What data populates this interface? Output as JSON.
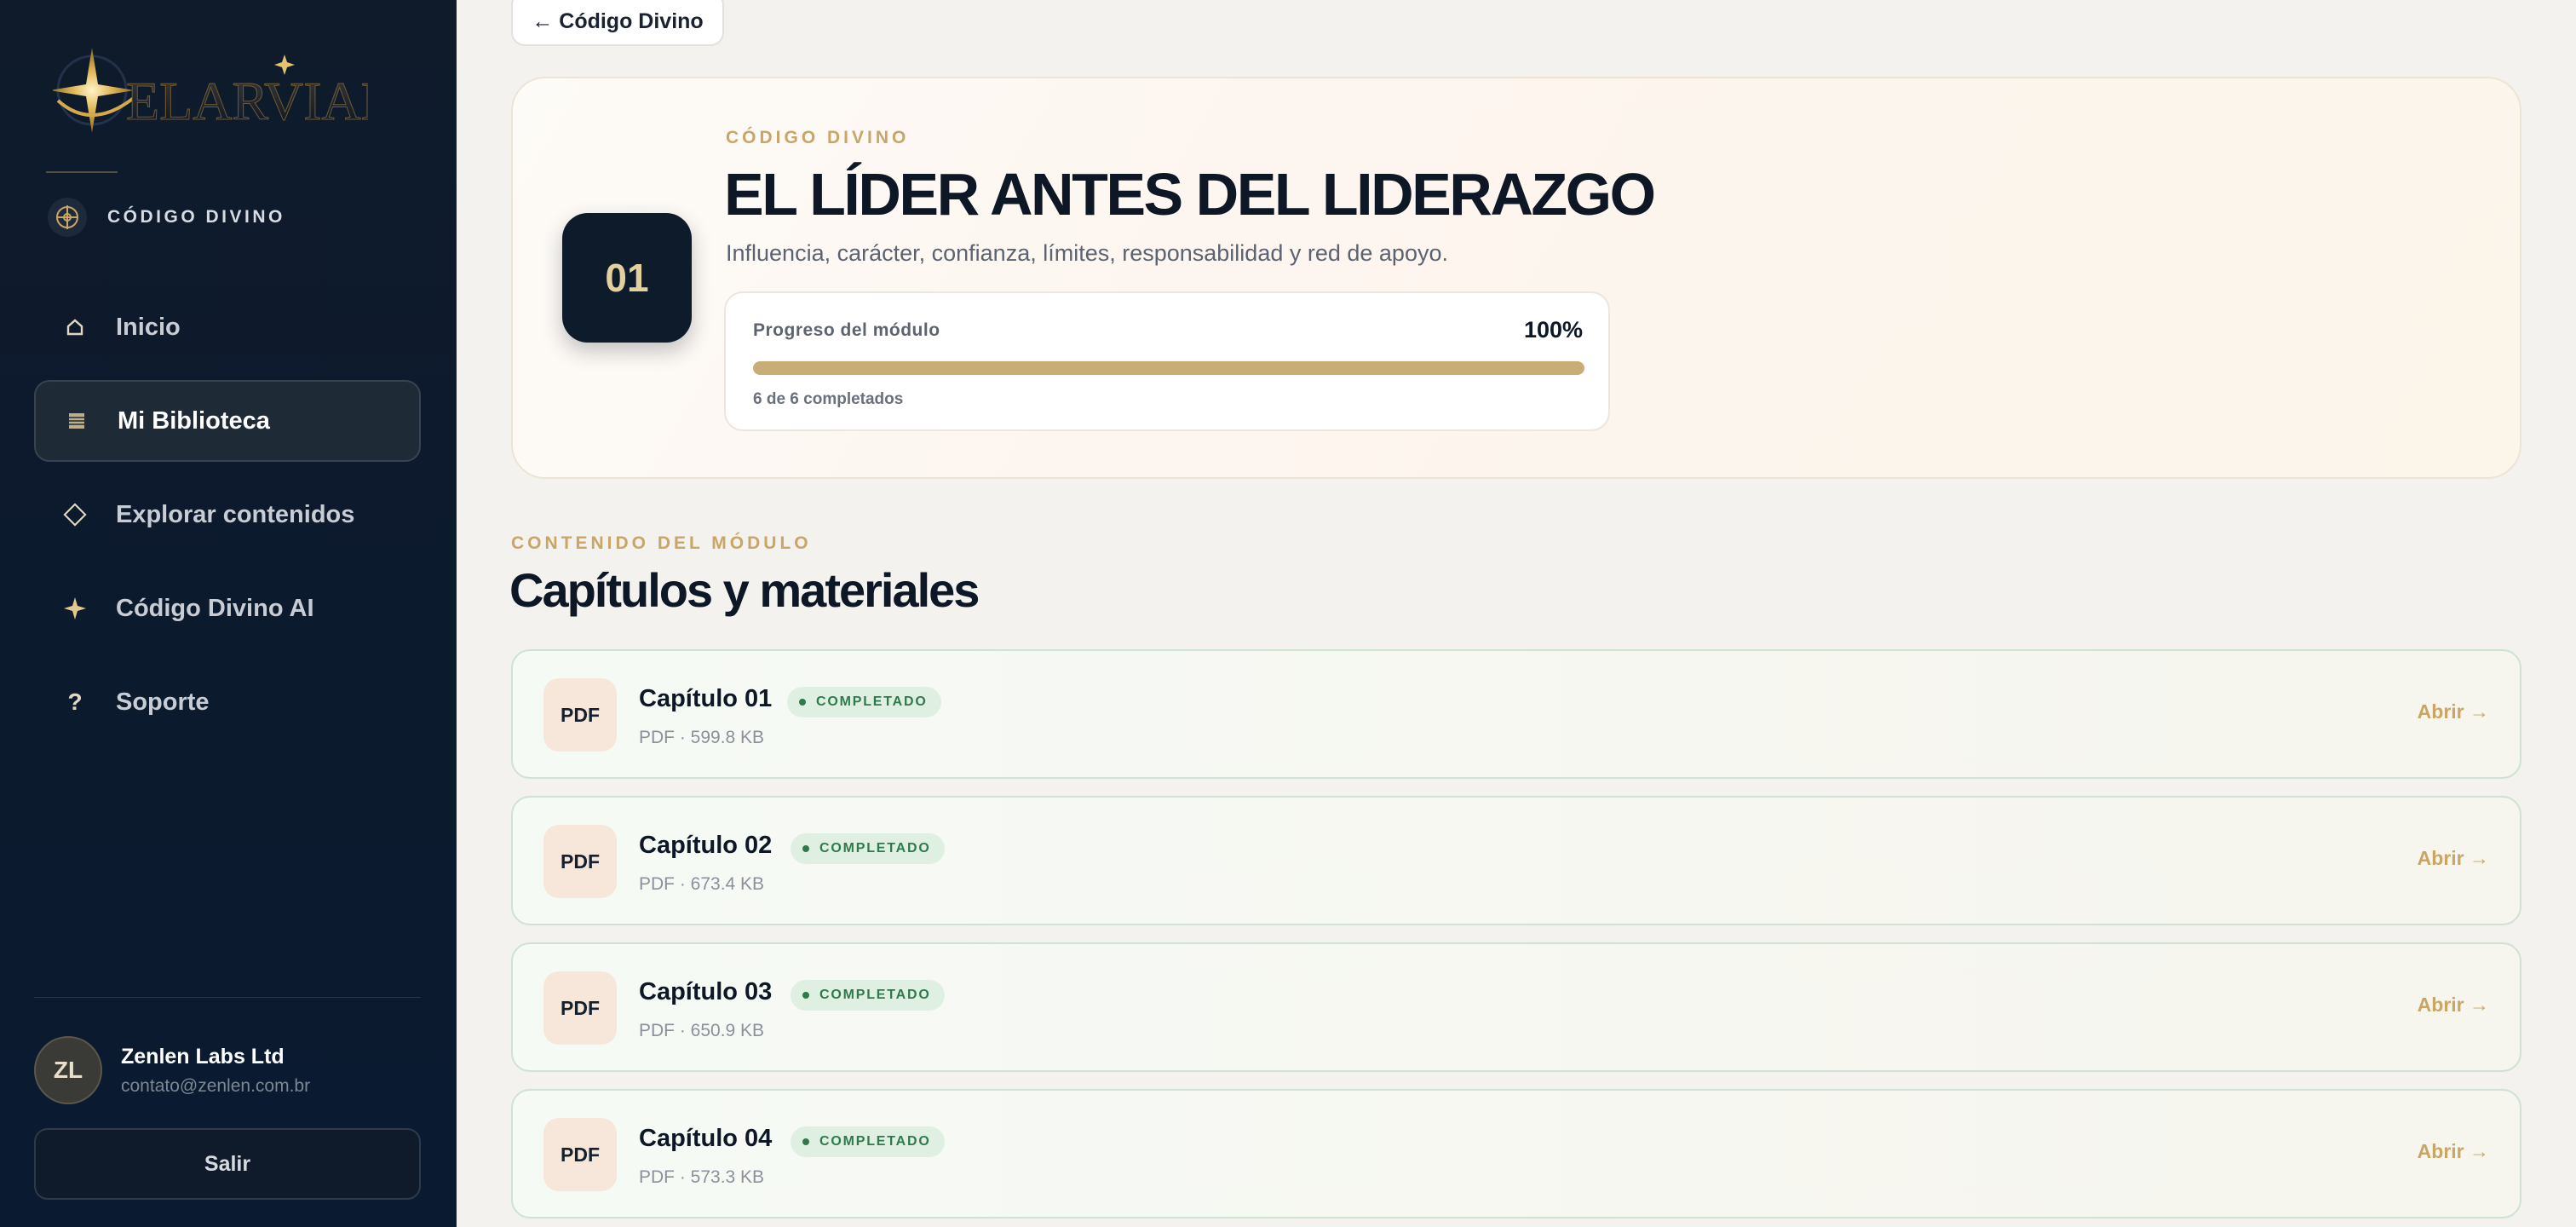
{
  "sidebar": {
    "brand_label": "CÓDIGO DIVINO",
    "nav": [
      {
        "label": "Inicio",
        "icon": "home-icon",
        "active": false
      },
      {
        "label": "Mi Biblioteca",
        "icon": "library-icon",
        "active": true
      },
      {
        "label": "Explorar contenidos",
        "icon": "diamond-icon",
        "active": false
      },
      {
        "label": "Código Divino AI",
        "icon": "sparkle-icon",
        "active": false
      },
      {
        "label": "Soporte",
        "icon": "question-icon",
        "active": false
      }
    ],
    "user": {
      "initials": "ZL",
      "name": "Zenlen Labs Ltd",
      "email": "contato@zenlen.com.br"
    },
    "logout_label": "Salir"
  },
  "main": {
    "back_label": "← Código Divino",
    "hero": {
      "module_number": "01",
      "eyebrow": "CÓDIGO DIVINO",
      "title": "EL LÍDER ANTES DEL LIDERAZGO",
      "subtitle": "Influencia, carácter, confianza, límites, responsabilidad y red de apoyo.",
      "progress": {
        "label": "Progreso del módulo",
        "percent_text": "100%",
        "fraction": 1.0,
        "count_text": "6 de 6 completados"
      }
    },
    "section": {
      "eyebrow": "CONTENIDO DEL MÓDULO",
      "title": "Capítulos y materiales"
    },
    "chapters": [
      {
        "icon_label": "PDF",
        "title": "Capítulo 01",
        "status": "COMPLETADO",
        "meta": "PDF · 599.8 KB",
        "action": "Abrir →"
      },
      {
        "icon_label": "PDF",
        "title": "Capítulo 02",
        "status": "COMPLETADO",
        "meta": "PDF · 673.4 KB",
        "action": "Abrir →"
      },
      {
        "icon_label": "PDF",
        "title": "Capítulo 03",
        "status": "COMPLETADO",
        "meta": "PDF · 650.9 KB",
        "action": "Abrir →"
      },
      {
        "icon_label": "PDF",
        "title": "Capítulo 04",
        "status": "COMPLETADO",
        "meta": "PDF · 573.3 KB",
        "action": "Abrir →"
      }
    ]
  },
  "colors": {
    "accent_gold": "#c9a566",
    "navy": "#0d1726",
    "success": "#2f7a4c"
  }
}
